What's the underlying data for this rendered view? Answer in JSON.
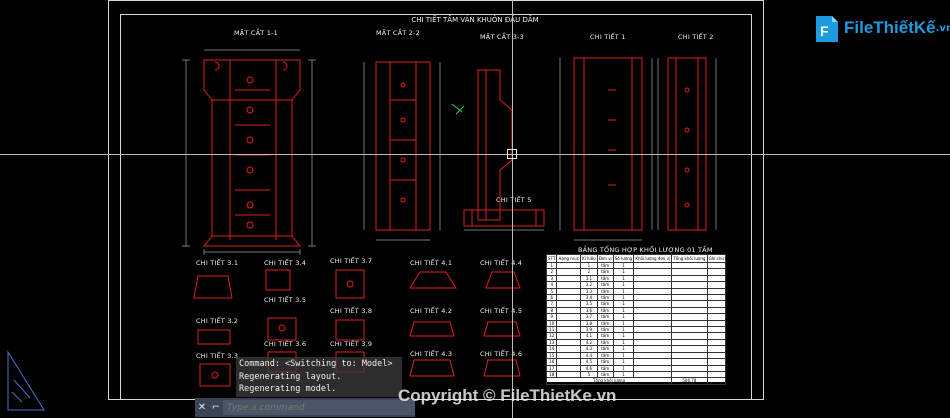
{
  "drawing": {
    "sheet_title": "CHI TIẾT TẤM VÁN KHUÔN ĐẦU DẦM",
    "sections": {
      "mc11": "MẶT CẮT 1-1",
      "mc22": "MẶT CẮT 2-2",
      "mc33": "MẶT CẮT 3-3",
      "ct1": "CHI TIẾT 1",
      "ct2": "CHI TIẾT 2",
      "ct5": "CHI TIẾT 5",
      "ct31a": "CHI TIẾT 3.1",
      "ct34": "CHI TIẾT 3.4",
      "ct37": "CHI TIẾT 3.7",
      "ct41": "CHI TIẾT 4.1",
      "ct44": "CHI TIẾT 4.4",
      "ct35": "CHI TIẾT 3.5",
      "ct38": "CHI TIẾT 3.8",
      "ct32": "CHI TIẾT 3.2",
      "ct42": "CHI TIẾT 4.2",
      "ct45": "CHI TIẾT 4.5",
      "ct33": "CHI TIẾT 3.3",
      "ct36": "CHI TIẾT 3.6",
      "ct39": "CHI TIẾT 3.9",
      "ct43": "CHI TIẾT 4.3",
      "ct46": "CHI TIẾT 4.6"
    },
    "table_title": "BẢNG TỔNG HỢP KHỐI LƯỢNG 01 TẤM"
  },
  "table": {
    "headers": [
      "STT",
      "Hạng mục",
      "Kí hiệu",
      "Đơn vị",
      "Số lượng",
      "Khối lượng đơn vị",
      "Tổng khối lượng",
      "Ghi chú"
    ],
    "rows": [
      [
        "1",
        "",
        "1",
        "tấm",
        "1",
        "",
        "",
        ""
      ],
      [
        "2",
        "",
        "2",
        "tấm",
        "1",
        "",
        "",
        ""
      ],
      [
        "3",
        "",
        "3.1",
        "tấm",
        "1",
        "",
        "",
        ""
      ],
      [
        "4",
        "",
        "3.2",
        "tấm",
        "1",
        "",
        "",
        ""
      ],
      [
        "5",
        "",
        "3.3",
        "tấm",
        "1",
        "",
        "",
        ""
      ],
      [
        "6",
        "",
        "3.4",
        "tấm",
        "1",
        "",
        "",
        ""
      ],
      [
        "7",
        "",
        "3.5",
        "tấm",
        "1",
        "",
        "",
        ""
      ],
      [
        "8",
        "",
        "3.6",
        "tấm",
        "1",
        "",
        "",
        ""
      ],
      [
        "9",
        "",
        "3.7",
        "tấm",
        "1",
        "",
        "",
        ""
      ],
      [
        "10",
        "",
        "3.8",
        "tấm",
        "1",
        "",
        "",
        ""
      ],
      [
        "11",
        "",
        "3.9",
        "tấm",
        "1",
        "",
        "",
        ""
      ],
      [
        "12",
        "",
        "4.1",
        "tấm",
        "1",
        "",
        "",
        ""
      ],
      [
        "13",
        "",
        "4.2",
        "tấm",
        "1",
        "",
        "",
        ""
      ],
      [
        "14",
        "",
        "4.3",
        "tấm",
        "1",
        "",
        "",
        ""
      ],
      [
        "15",
        "",
        "4.4",
        "tấm",
        "1",
        "",
        "",
        ""
      ],
      [
        "16",
        "",
        "4.5",
        "tấm",
        "1",
        "",
        "",
        ""
      ],
      [
        "17",
        "",
        "4.6",
        "tấm",
        "1",
        "",
        "",
        ""
      ],
      [
        "18",
        "",
        "5",
        "tấm",
        "1",
        "",
        "",
        ""
      ]
    ],
    "total_label": "Tổng khối lượng",
    "total_value": "506.78"
  },
  "command": {
    "history": [
      "Command: <Switching to: Model>",
      "Regenerating layout.",
      "Regenerating model."
    ],
    "placeholder": "Type a command",
    "close_glyph": "✕",
    "tool_glyph": "⌐"
  },
  "logo": {
    "brand": "FileThiếtKế",
    "tld": ".vn"
  },
  "watermark": "Copyright © FileThietKe.vn",
  "colors": {
    "background": "#000000",
    "drawing_red": "#e0201c",
    "drawing_white": "#e8e8e8",
    "command_bar": "#3b4453",
    "logo_blue": "#1e9be0",
    "ucs_blue": "#4a6fd0"
  }
}
